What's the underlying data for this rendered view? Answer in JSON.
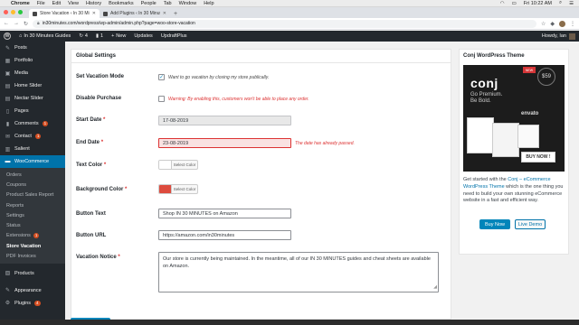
{
  "mac_menu": {
    "app": "Chrome",
    "items": [
      "File",
      "Edit",
      "View",
      "History",
      "Bookmarks",
      "People",
      "Tab",
      "Window",
      "Help"
    ],
    "time": "Fri 10:22 AM"
  },
  "tabs": [
    {
      "title": "Store Vacation ‹ In 30 Minut...",
      "active": true
    },
    {
      "title": "Add Plugins ‹ In 30 Minutes G...",
      "active": false
    }
  ],
  "address": "in30minutes.com/wordpress/wp-admin/admin.php?page=woo-store-vacation",
  "adminbar": {
    "site": "In 30 Minutes Guides",
    "updates_count": "4",
    "comments_count": "1",
    "new_label": "New",
    "updates_label": "Updates",
    "updraft_label": "UpdraftPlus",
    "howdy": "Howdy, Ian"
  },
  "sidebar": {
    "items_top": [
      {
        "label": "Posts",
        "icon": "pin-icon"
      },
      {
        "label": "Portfolio",
        "icon": "portfolio-icon"
      },
      {
        "label": "Media",
        "icon": "media-icon"
      },
      {
        "label": "Home Slider",
        "icon": "slider-icon"
      },
      {
        "label": "Nectar Slider",
        "icon": "slider-icon"
      },
      {
        "label": "Pages",
        "icon": "page-icon"
      }
    ],
    "comments": {
      "label": "Comments",
      "badge": "1"
    },
    "contact": {
      "label": "Contact",
      "badge": "1"
    },
    "salient": {
      "label": "Salient"
    },
    "woocommerce": {
      "label": "WooCommerce"
    },
    "submenu": [
      {
        "label": "Orders"
      },
      {
        "label": "Coupons"
      },
      {
        "label": "Product Sales Report"
      },
      {
        "label": "Reports"
      },
      {
        "label": "Settings"
      },
      {
        "label": "Status"
      },
      {
        "label": "Extensions",
        "badge": "1"
      },
      {
        "label": "Store Vacation",
        "current": true
      },
      {
        "label": "PDF Invoices"
      }
    ],
    "items_bottom": [
      {
        "label": "Products"
      },
      {
        "label": "Appearance"
      },
      {
        "label": "Plugins",
        "badge": "4"
      }
    ]
  },
  "settings": {
    "section_title": "Global Settings",
    "vacation_mode": {
      "label": "Set Vacation Mode",
      "checked": true,
      "desc": "Want to go vacation by closing my store publically."
    },
    "disable_purchase": {
      "label": "Disable Purchase",
      "checked": false,
      "desc": "Warning: By enabling this, customers won't be able to place any order."
    },
    "start_date": {
      "label": "Start Date",
      "required": "*",
      "value": "17-08-2019"
    },
    "end_date": {
      "label": "End Date",
      "required": "*",
      "value": "23-08-2019",
      "error": "The date has already passed."
    },
    "text_color": {
      "label": "Text Color",
      "required": "*",
      "button": "Select Color",
      "color": "#ffffff"
    },
    "bg_color": {
      "label": "Background Color",
      "required": "*",
      "button": "Select Color",
      "color": "#dd4b3e"
    },
    "button_text": {
      "label": "Button Text",
      "value": "Shop IN 30 MINUTES on Amazon"
    },
    "button_url": {
      "label": "Button URL",
      "value": "https://amazon.com/in30minutes"
    },
    "notice": {
      "label": "Vacation Notice",
      "required": "*",
      "value": "Our store is currently being maintained. In the meantime, all of our IN 30 MINUTES guides and cheat sheets are available on Amazon."
    }
  },
  "widget": {
    "title": "Conj WordPress Theme",
    "promo_logo": "conj",
    "promo_line1": "Go Premium.",
    "promo_line2": "Be Bold.",
    "promo_envato": "envato",
    "promo_ribbon": "NEW",
    "promo_badge": "$59",
    "promo_buy": "BUY NOW !",
    "text_before": "Get started with the ",
    "text_link": "Conj – eCommerce WordPress Theme",
    "text_after": " which is the one thing you need to build your own stunning eCommerce website in a fast and efficient way.",
    "buy_label": "Buy Now",
    "demo_label": "Live Demo"
  }
}
